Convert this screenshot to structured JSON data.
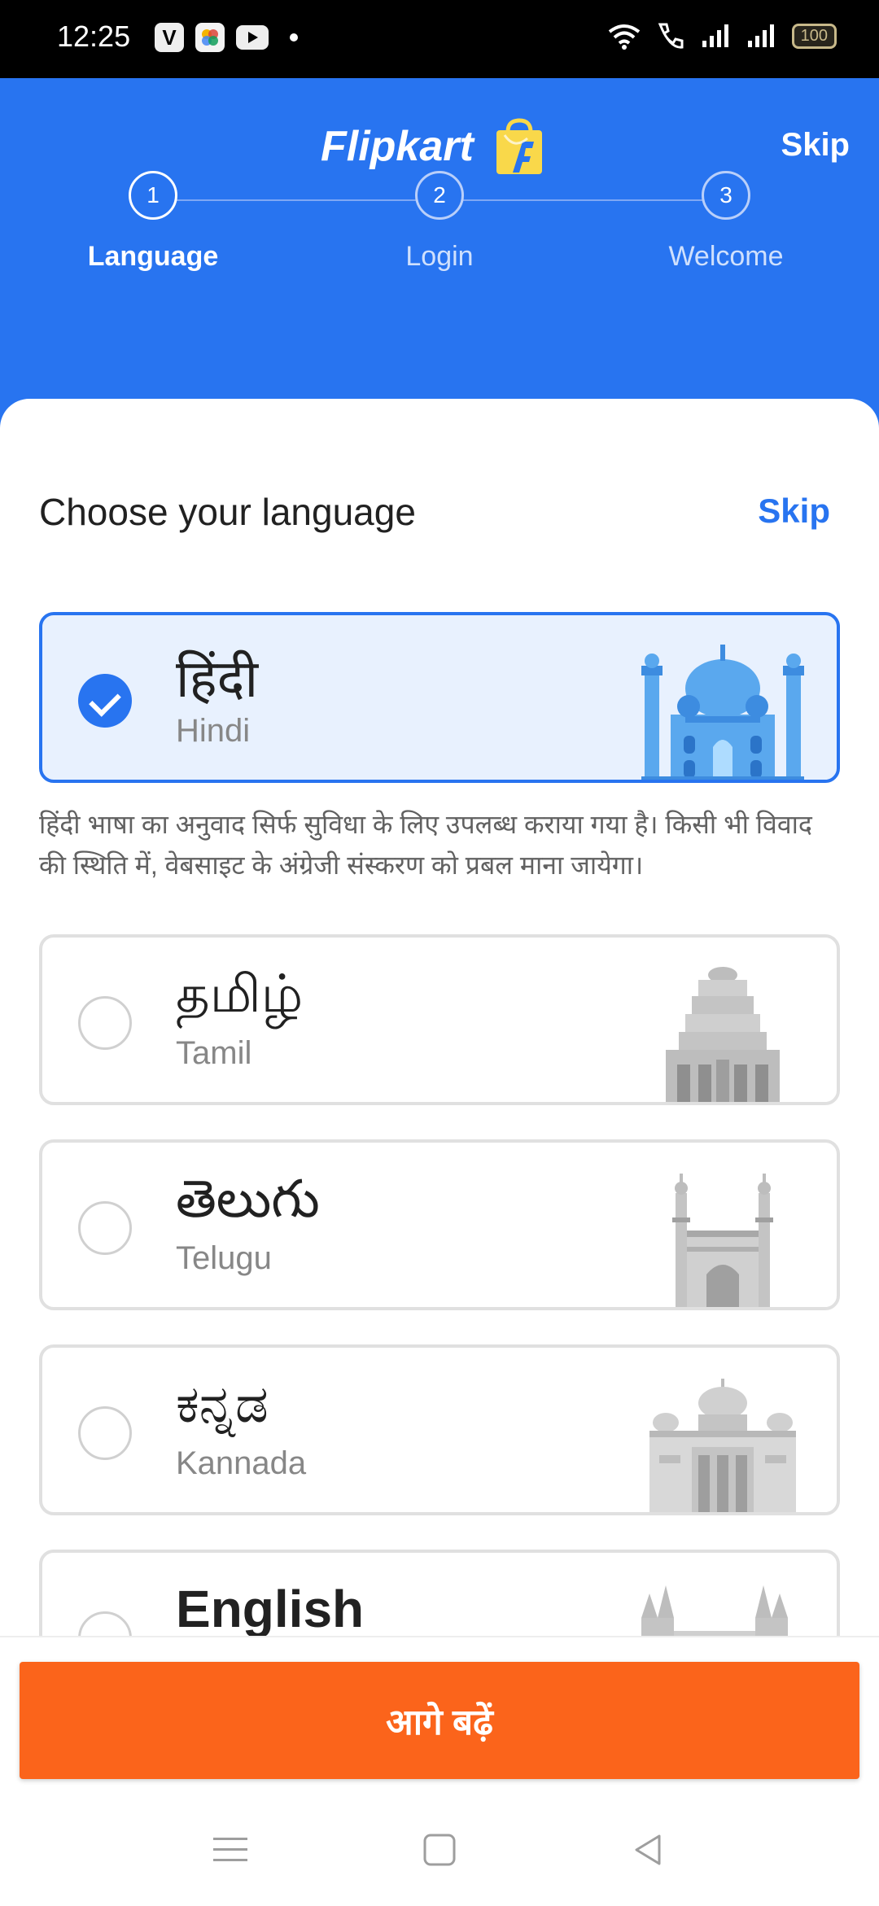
{
  "status_bar": {
    "time": "12:25",
    "app_icon_letter": "V",
    "battery": "100"
  },
  "header": {
    "brand": "Flipkart",
    "skip": "Skip",
    "steps": [
      {
        "number": "1",
        "label": "Language",
        "active": true
      },
      {
        "number": "2",
        "label": "Login",
        "active": false
      },
      {
        "number": "3",
        "label": "Welcome",
        "active": false
      }
    ]
  },
  "sheet": {
    "title": "Choose your language",
    "skip": "Skip",
    "disclaimer": "हिंदी भाषा का अनुवाद सिर्फ सुविधा के लिए उपलब्ध कराया गया है। किसी भी विवाद की स्थिति में, वेबसाइट के अंग्रेजी संस्करण को प्रबल माना जायेगा।",
    "languages": [
      {
        "native": "हिंदी",
        "english": "Hindi",
        "selected": true
      },
      {
        "native": "தமிழ்",
        "english": "Tamil",
        "selected": false
      },
      {
        "native": "తెలుగు",
        "english": "Telugu",
        "selected": false
      },
      {
        "native": "ಕನ್ನಡ",
        "english": "Kannada",
        "selected": false
      },
      {
        "native": "English",
        "english": "",
        "selected": false
      }
    ]
  },
  "footer": {
    "continue_button": "आगे बढ़ें"
  },
  "colors": {
    "primary": "#2874f0",
    "cta": "#fb641b",
    "selected_bg": "#e8f1fe"
  }
}
